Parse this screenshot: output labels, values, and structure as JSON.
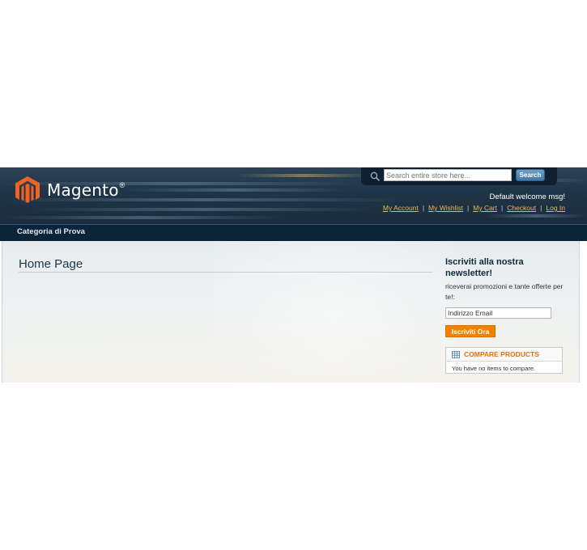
{
  "header": {
    "logo_text": "Magento",
    "logo_reg": "®",
    "search": {
      "placeholder": "Search entire store here...",
      "button_label": "Search"
    },
    "welcome": "Default welcome msg!",
    "links": [
      "My Account",
      "My Wishlist",
      "My Cart",
      "Checkout",
      "Log In"
    ],
    "link_separator": "|"
  },
  "nav": {
    "items": [
      "Categoria di Prova"
    ]
  },
  "main": {
    "title": "Home Page"
  },
  "sidebar": {
    "newsletter": {
      "title": "Iscriviti alla nostra newsletter!",
      "description": "riceverai promozioni e tante offerte per te!:",
      "input_value": "Indirizzo Email",
      "button_label": "Iscriviti Ora"
    },
    "compare": {
      "title": "COMPARE PRODUCTS",
      "empty_text": "You have no items to compare."
    }
  },
  "colors": {
    "header_bg": "#1f3447",
    "nav_bg": "#0c2438",
    "accent_orange": "#f18200",
    "link_gold": "#eab74c",
    "search_button": "#3f77a6"
  },
  "icons": [
    "magento-logo-icon",
    "search-icon",
    "compare-table-icon"
  ]
}
